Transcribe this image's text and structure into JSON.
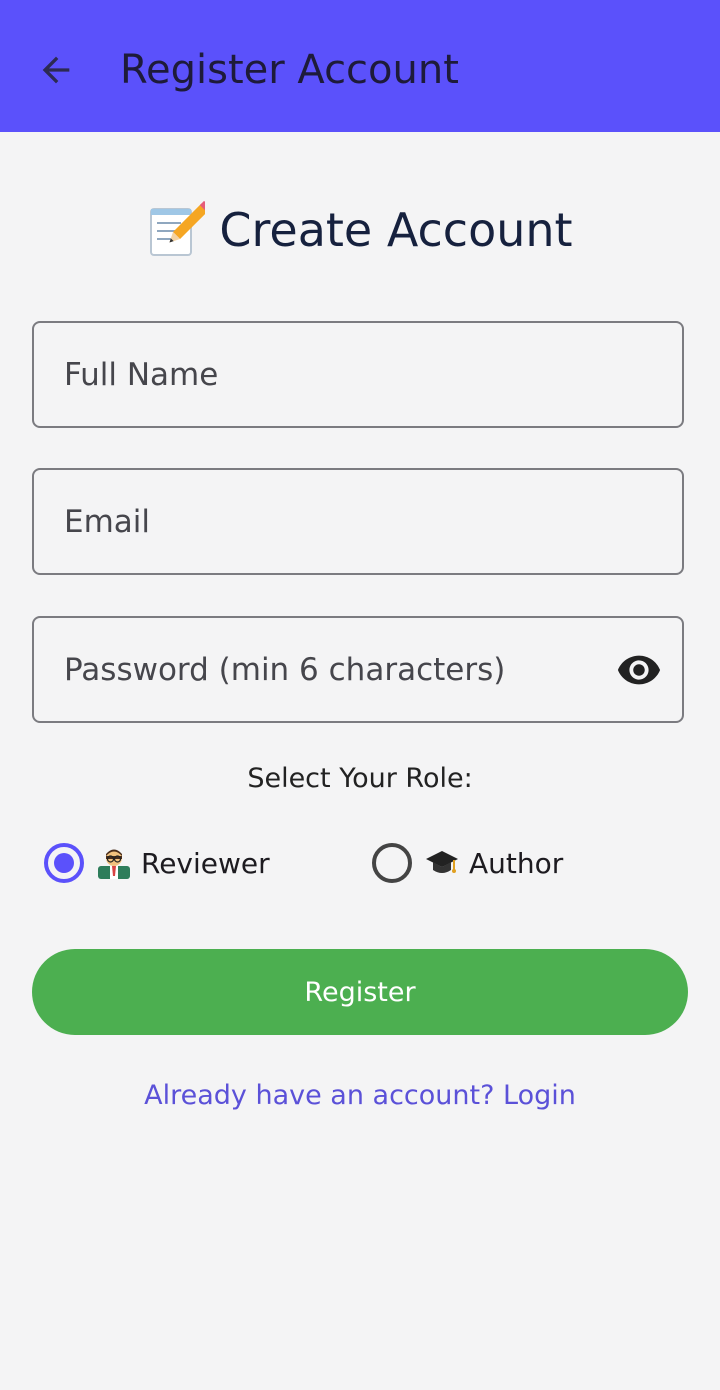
{
  "colors": {
    "appbar": "#5b51fb",
    "background": "#f4f4f5",
    "accent": "#5b51fb",
    "register_button": "#4caf50",
    "link": "#5b51d8"
  },
  "appbar": {
    "back_icon": "arrow-left-icon",
    "title": "Register Account"
  },
  "heading": {
    "icon": "memo-pencil-icon",
    "text": "Create Account"
  },
  "form": {
    "full_name": {
      "placeholder": "Full Name",
      "value": ""
    },
    "email": {
      "placeholder": "Email",
      "value": ""
    },
    "password": {
      "placeholder": "Password (min 6 characters)",
      "value": "",
      "toggle_icon": "eye-icon"
    }
  },
  "role": {
    "label": "Select Your Role:",
    "options": [
      {
        "label": "Reviewer",
        "icon": "teacher-icon",
        "selected": true
      },
      {
        "label": "Author",
        "icon": "graduation-cap-icon",
        "selected": false
      }
    ]
  },
  "register_button": {
    "label": "Register"
  },
  "login_link": {
    "text": "Already have an account? Login"
  }
}
